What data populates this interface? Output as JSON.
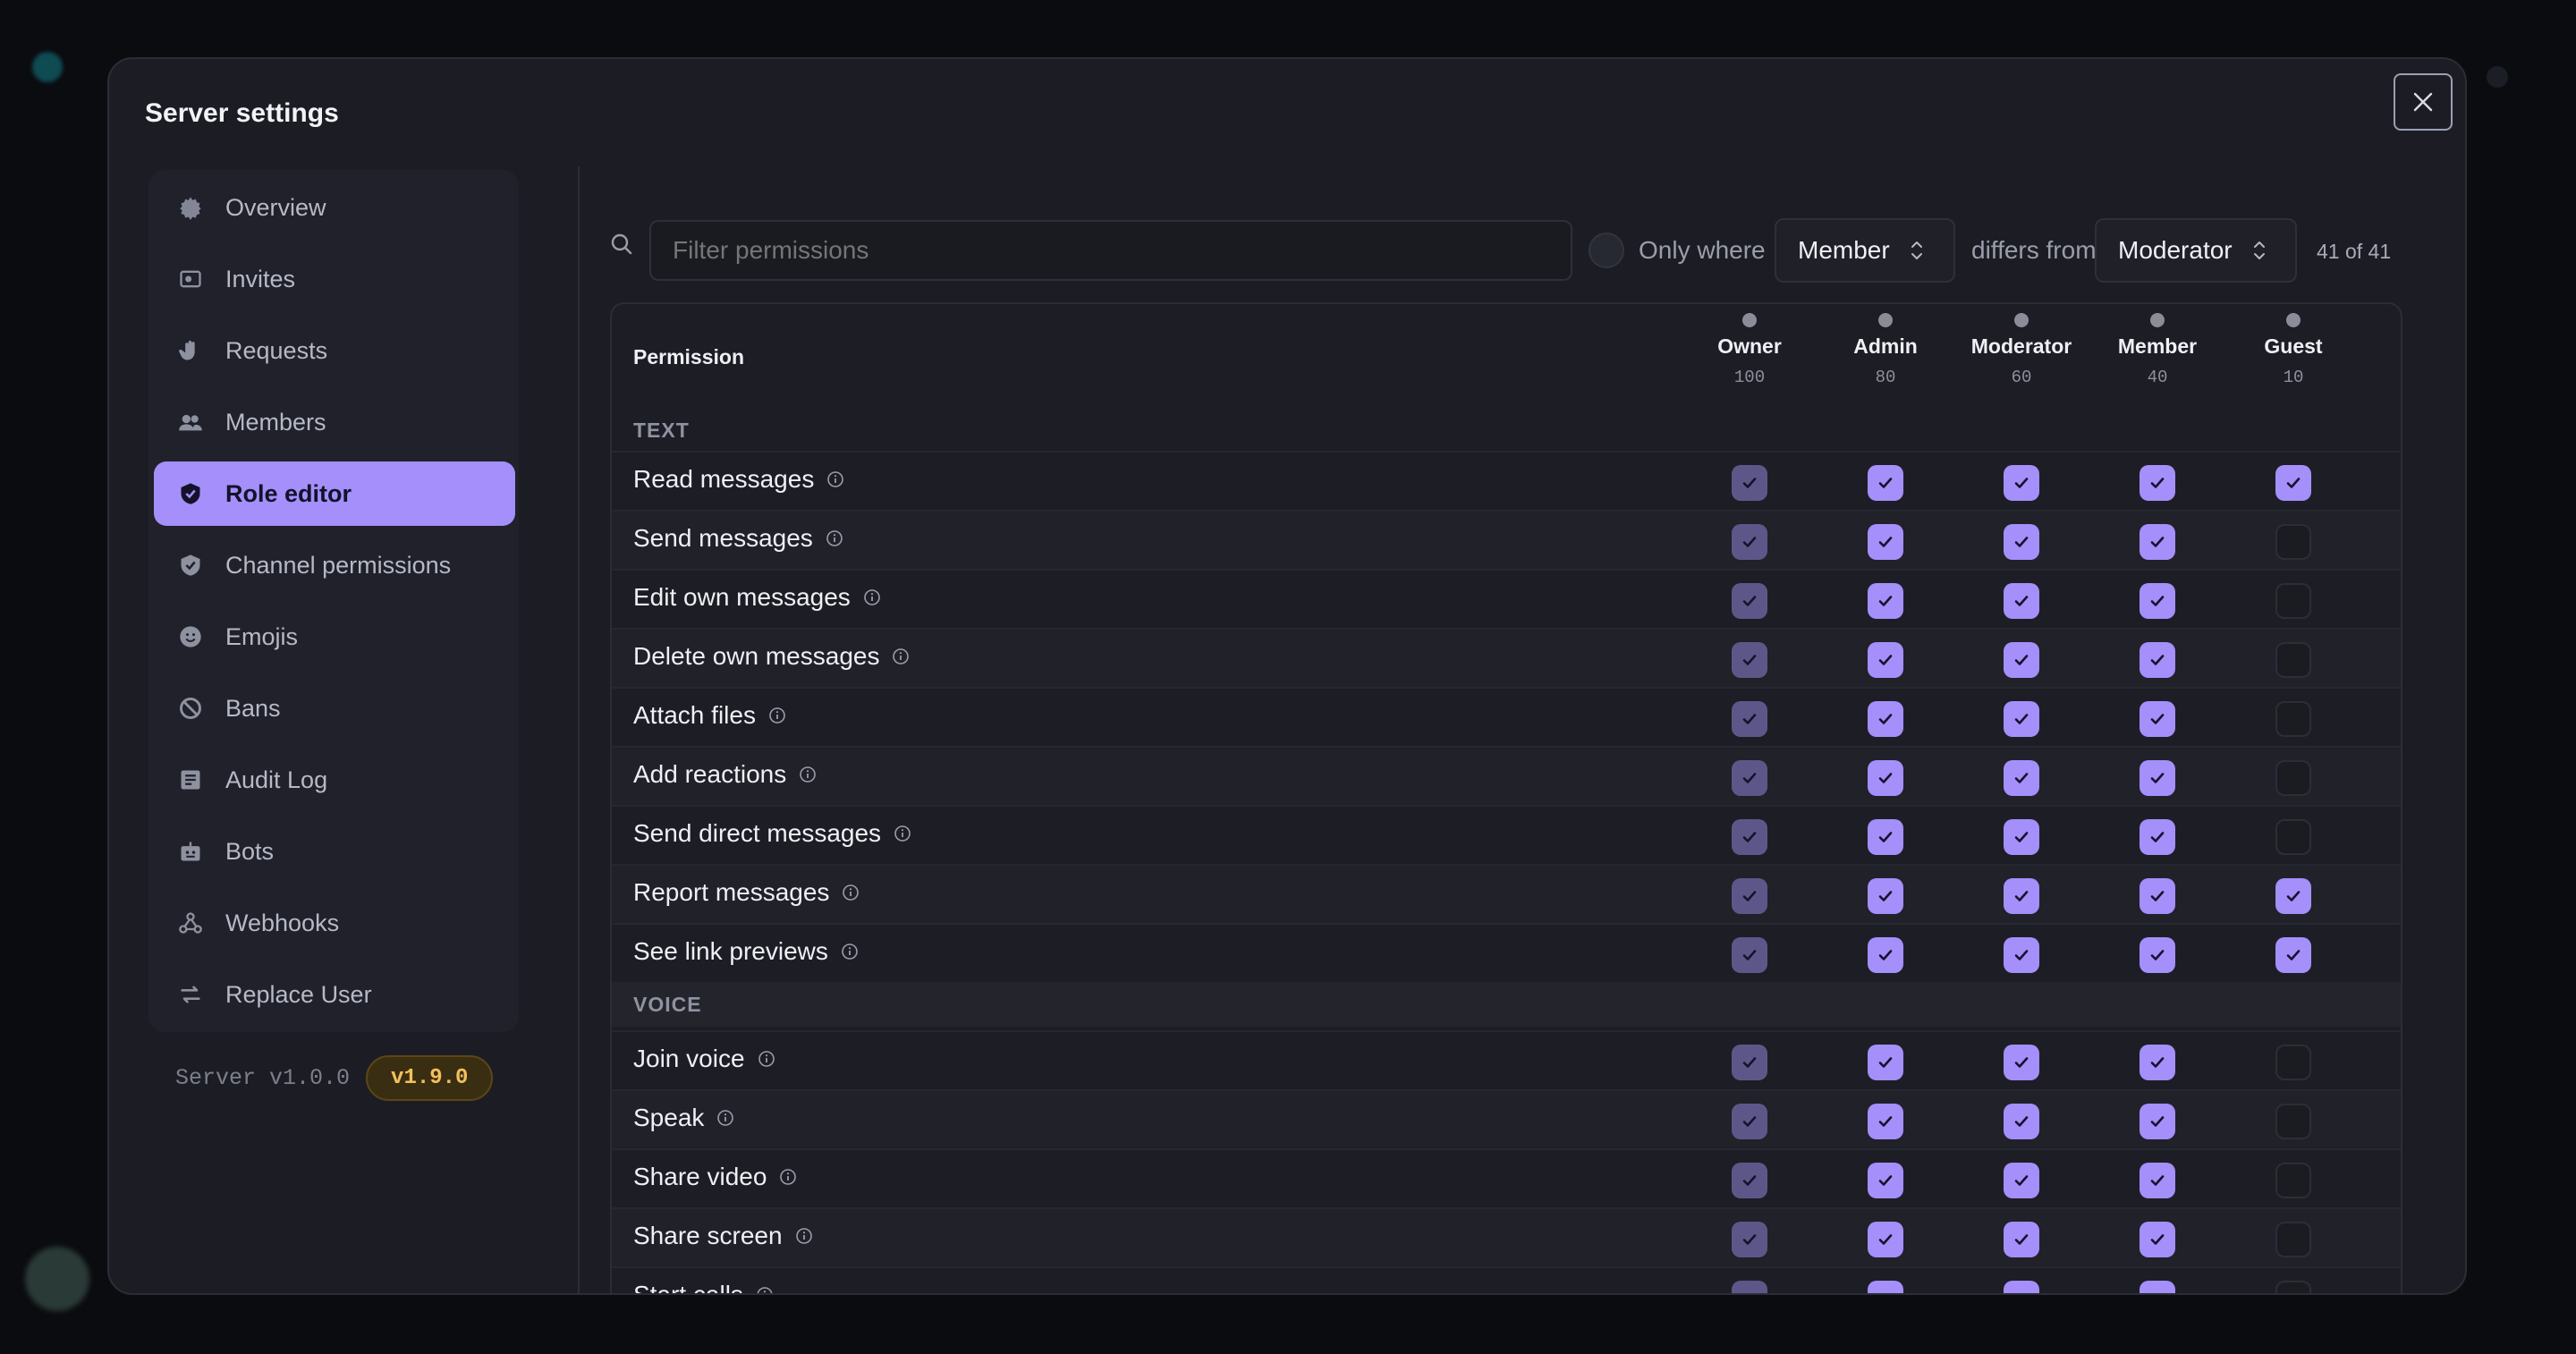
{
  "modal": {
    "title": "Server settings",
    "close_icon": "close-icon"
  },
  "sidebar": {
    "items": [
      {
        "label": "Overview",
        "icon": "gear-icon",
        "active": false
      },
      {
        "label": "Invites",
        "icon": "invite-icon",
        "active": false
      },
      {
        "label": "Requests",
        "icon": "hand-icon",
        "active": false
      },
      {
        "label": "Members",
        "icon": "members-icon",
        "active": false
      },
      {
        "label": "Role editor",
        "icon": "shield-icon",
        "active": true
      },
      {
        "label": "Channel permissions",
        "icon": "shield-outline-icon",
        "active": false
      },
      {
        "label": "Emojis",
        "icon": "smile-icon",
        "active": false
      },
      {
        "label": "Bans",
        "icon": "ban-icon",
        "active": false
      },
      {
        "label": "Audit Log",
        "icon": "list-icon",
        "active": false
      },
      {
        "label": "Bots",
        "icon": "bot-icon",
        "active": false
      },
      {
        "label": "Webhooks",
        "icon": "webhook-icon",
        "active": false
      },
      {
        "label": "Replace User",
        "icon": "swap-icon",
        "active": false
      }
    ],
    "version_text": "Server v1.0.0",
    "version_badge": "v1.9.0"
  },
  "toolbar": {
    "filter_placeholder": "Filter permissions",
    "only_where_label": "Only where",
    "role_a": "Member",
    "differs_label": "differs from",
    "role_b": "Moderator",
    "count": "41 of 41"
  },
  "table": {
    "permission_header": "Permission",
    "roles": [
      {
        "name": "Owner",
        "level": "100"
      },
      {
        "name": "Admin",
        "level": "80"
      },
      {
        "name": "Moderator",
        "level": "60"
      },
      {
        "name": "Member",
        "level": "40"
      },
      {
        "name": "Guest",
        "level": "10"
      }
    ],
    "sections": [
      {
        "title": "TEXT",
        "rows": [
          {
            "label": "Read messages",
            "values": [
              true,
              true,
              true,
              true,
              true
            ]
          },
          {
            "label": "Send messages",
            "values": [
              true,
              true,
              true,
              true,
              false
            ]
          },
          {
            "label": "Edit own messages",
            "values": [
              true,
              true,
              true,
              true,
              false
            ]
          },
          {
            "label": "Delete own messages",
            "values": [
              true,
              true,
              true,
              true,
              false
            ]
          },
          {
            "label": "Attach files",
            "values": [
              true,
              true,
              true,
              true,
              false
            ]
          },
          {
            "label": "Add reactions",
            "values": [
              true,
              true,
              true,
              true,
              false
            ]
          },
          {
            "label": "Send direct messages",
            "values": [
              true,
              true,
              true,
              true,
              false
            ]
          },
          {
            "label": "Report messages",
            "values": [
              true,
              true,
              true,
              true,
              true
            ]
          },
          {
            "label": "See link previews",
            "values": [
              true,
              true,
              true,
              true,
              true
            ]
          }
        ]
      },
      {
        "title": "VOICE",
        "rows": [
          {
            "label": "Join voice",
            "values": [
              true,
              true,
              true,
              true,
              false
            ]
          },
          {
            "label": "Speak",
            "values": [
              true,
              true,
              true,
              true,
              false
            ]
          },
          {
            "label": "Share video",
            "values": [
              true,
              true,
              true,
              true,
              false
            ]
          },
          {
            "label": "Share screen",
            "values": [
              true,
              true,
              true,
              true,
              false
            ]
          },
          {
            "label": "Start calls",
            "values": [
              true,
              true,
              true,
              true,
              false
            ]
          }
        ]
      }
    ]
  }
}
